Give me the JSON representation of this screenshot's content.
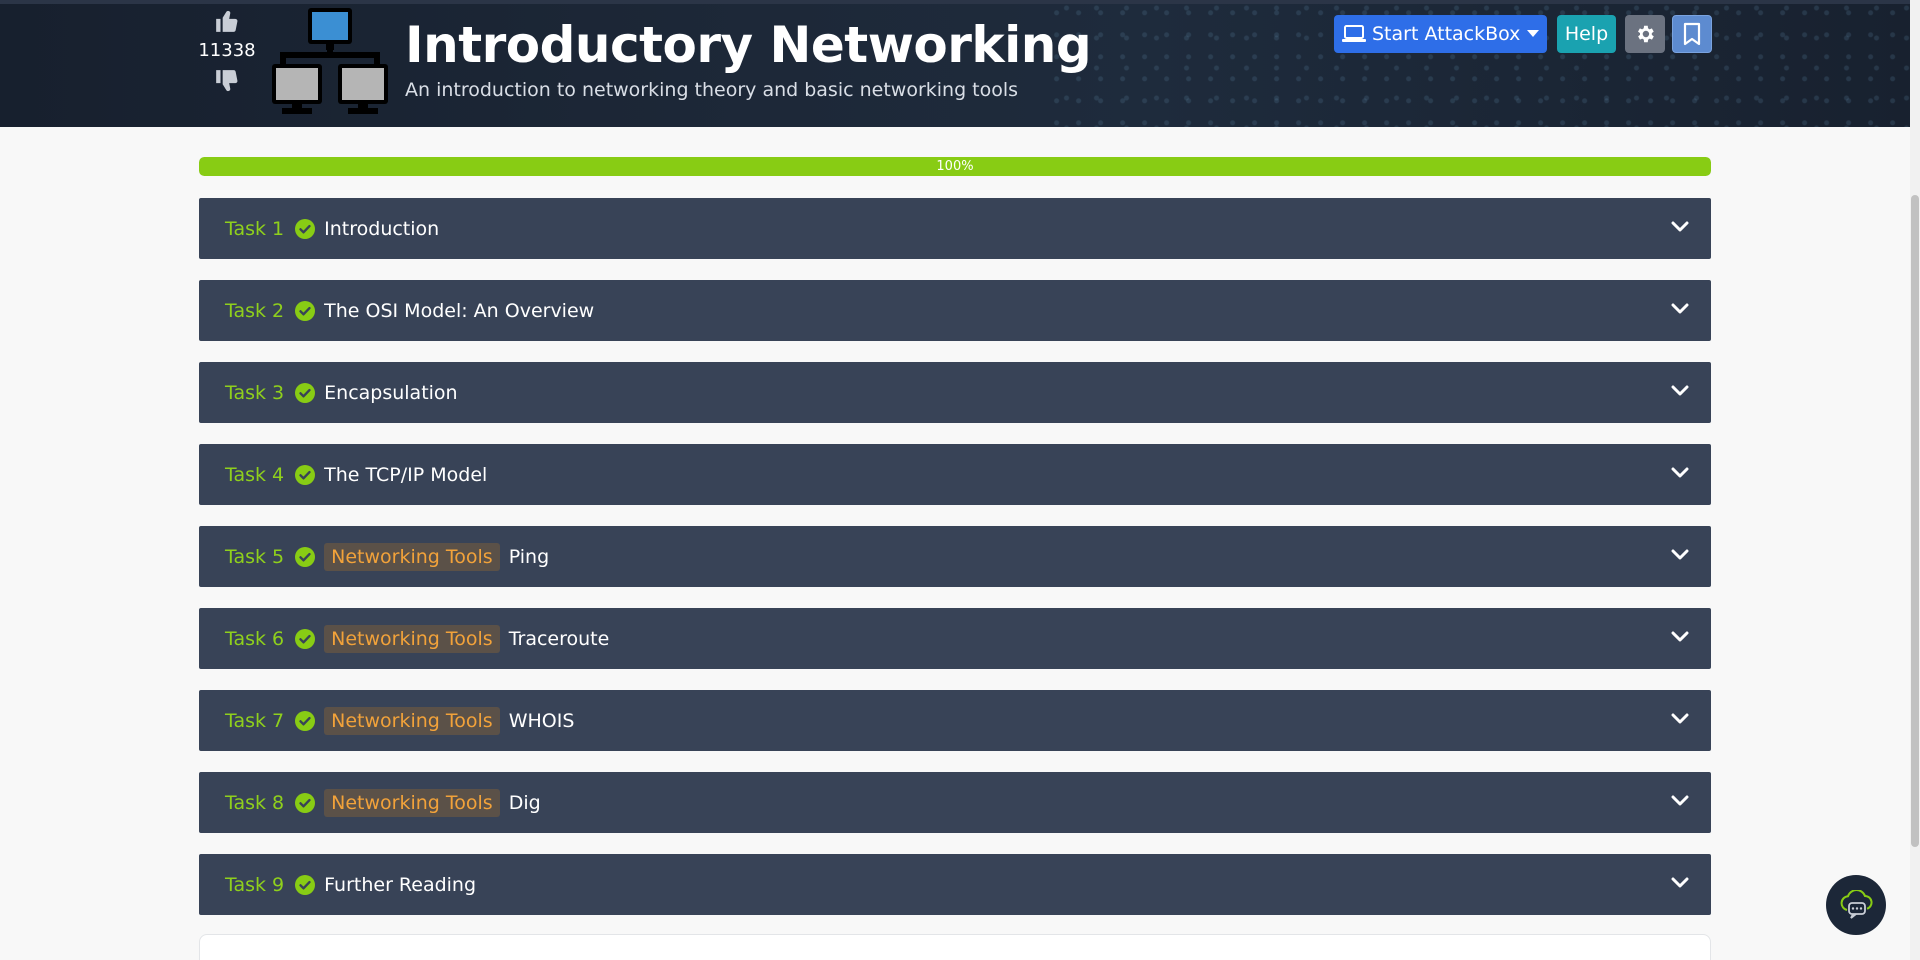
{
  "room": {
    "title": "Introductory Networking",
    "subtitle": "An introduction to networking theory and basic networking tools",
    "vote_count": "11338"
  },
  "actions": {
    "attackbox_label": "Start AttackBox",
    "help_label": "Help"
  },
  "progress": {
    "percent_label": "100%",
    "value": 100
  },
  "tasks": [
    {
      "num": "Task 1",
      "tag": "",
      "title": "Introduction"
    },
    {
      "num": "Task 2",
      "tag": "",
      "title": "The OSI Model: An Overview"
    },
    {
      "num": "Task 3",
      "tag": "",
      "title": "Encapsulation"
    },
    {
      "num": "Task 4",
      "tag": "",
      "title": "The TCP/IP Model"
    },
    {
      "num": "Task 5",
      "tag": "Networking Tools",
      "title": "Ping"
    },
    {
      "num": "Task 6",
      "tag": "Networking Tools",
      "title": "Traceroute"
    },
    {
      "num": "Task 7",
      "tag": "Networking Tools",
      "title": "WHOIS"
    },
    {
      "num": "Task 8",
      "tag": "Networking Tools",
      "title": "Dig"
    },
    {
      "num": "Task 9",
      "tag": "",
      "title": "Further Reading"
    }
  ],
  "colors": {
    "header_bg": "#1d2838",
    "task_bg": "#384357",
    "accent_green": "#88cc14",
    "tag_orange": "#f2a23a",
    "attackbox_blue": "#2e6ee8",
    "help_teal": "#1aa2b0"
  },
  "icons": {
    "upvote": "thumbs-up-icon",
    "downvote": "thumbs-down-icon",
    "room": "network-computers-icon",
    "attackbox": "laptop-icon",
    "settings": "gear-icon",
    "bookmark": "bookmark-icon",
    "complete": "check-circle-icon",
    "expand": "chevron-down-icon",
    "chat": "chat-icon"
  }
}
